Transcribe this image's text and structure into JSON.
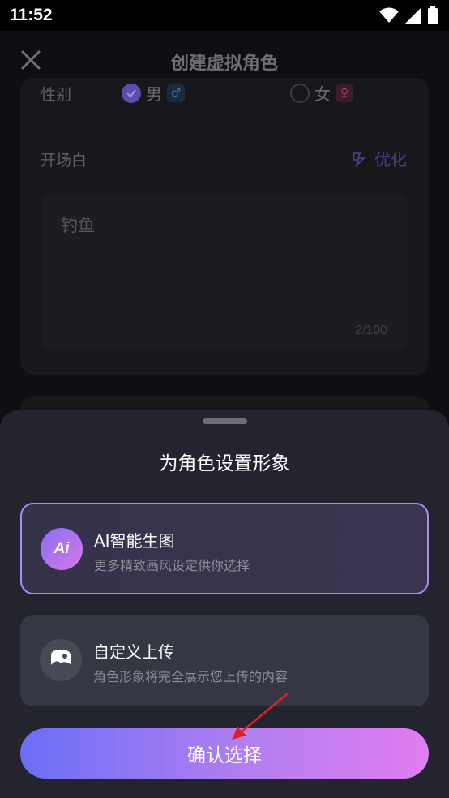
{
  "status_bar": {
    "time": "11:52"
  },
  "nav": {
    "title": "创建虚拟角色"
  },
  "form": {
    "gender_label": "性别",
    "gender_male": "男",
    "gender_female": "女",
    "opening_label": "开场白",
    "optimize_label": "优化",
    "opening_value": "钓鱼",
    "opening_count": "2/100"
  },
  "sheet": {
    "title": "为角色设置形象",
    "options": [
      {
        "name": "AI智能生图",
        "desc": "更多精致画风设定供你选择",
        "icon": "ai-icon",
        "icon_text": "Ai",
        "selected": true
      },
      {
        "name": "自定义上传",
        "desc": "角色形象将完全展示您上传的内容",
        "icon": "image-icon",
        "selected": false
      }
    ],
    "confirm_label": "确认选择"
  },
  "colors": {
    "accent_gradient_start": "#6c6ff6",
    "accent_gradient_end": "#e07ef0",
    "selected_border": "#a98cf0",
    "annotation_arrow": "#e02020"
  }
}
